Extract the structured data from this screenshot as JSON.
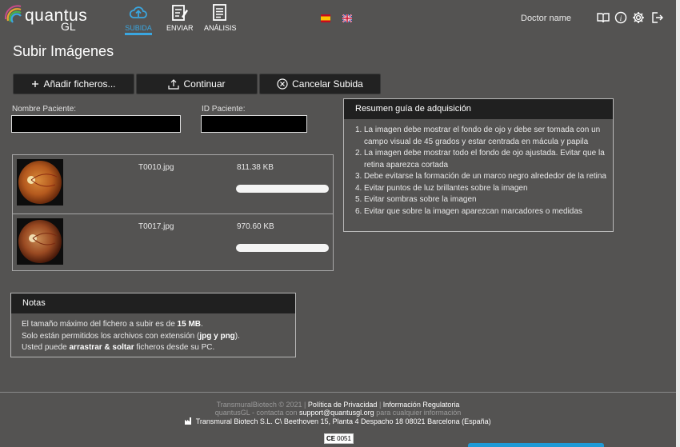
{
  "brand": {
    "name": "quantus",
    "sub": "GL"
  },
  "nav": [
    {
      "label": "SUBIDA",
      "active": true,
      "icon": "cloud-upload-icon"
    },
    {
      "label": "ENVIAR",
      "active": false,
      "icon": "edit-document-icon"
    },
    {
      "label": "ANÁLISIS",
      "active": false,
      "icon": "report-document-icon"
    }
  ],
  "languages": [
    "es-flag-icon",
    "uk-flag-icon"
  ],
  "user": {
    "name": "Doctor name"
  },
  "header_icons": [
    "book-icon",
    "info-icon",
    "gear-icon",
    "logout-icon"
  ],
  "page": {
    "title": "Subir Imágenes"
  },
  "actions": {
    "add": "Añadir ficheros...",
    "continue": "Continuar",
    "cancel": "Cancelar Subida"
  },
  "form": {
    "patient_name_label": "Nombre Paciente:",
    "patient_name_value": "",
    "patient_id_label": "ID Paciente:",
    "patient_id_value": ""
  },
  "files": [
    {
      "name": "T0010.jpg",
      "size": "811.38 KB",
      "progress": 0
    },
    {
      "name": "T0017.jpg",
      "size": "970.60 KB",
      "progress": 0
    }
  ],
  "guide": {
    "title": "Resumen guía de adquisición",
    "items": [
      "La imagen debe mostrar el fondo de ojo y debe ser tomada con un campo visual de 45 grados y estar centrada en mácula y papila",
      "La imagen debe mostrar todo el fondo de ojo ajustada. Evitar que la retina aparezca cortada",
      "Debe evitarse la formación de un marco negro alrededor de la retina",
      "Evitar puntos de luz brillantes sobre la imagen",
      "Evitar sombras sobre la imagen",
      "Evitar que sobre la imagen aparezcan marcadores o medidas"
    ]
  },
  "notes": {
    "title": "Notas",
    "line1_pre": "El tamaño máximo del fichero a subir es de ",
    "line1_bold": "15 MB",
    "line1_post": ".",
    "line2_pre": "Solo están permitidos los archivos con extensión (",
    "line2_bold": "jpg y png",
    "line2_post": ").",
    "line3_pre": "Usted puede ",
    "line3_bold": "arrastrar & soltar",
    "line3_post": " ficheros desde su PC."
  },
  "footer": {
    "copyright": "TransmuralBiotech © 2021",
    "sep": "|",
    "privacy": "Política de Privacidad",
    "regulatory": "Información Regulatoria",
    "contact_pre": "quantusGL - contacta con ",
    "contact_email": "support@quantusgl.org",
    "contact_post": " para cualquier información",
    "address": "Transmural Biotech S.L. C\\ Beethoven 15, Planta 4 Despacho 18 08021 Barcelona (España)",
    "ce_mark": "CE",
    "ce_number": "0051"
  },
  "colors": {
    "accent": "#3aa6e0",
    "background": "#545352",
    "panel_header": "#202020"
  }
}
